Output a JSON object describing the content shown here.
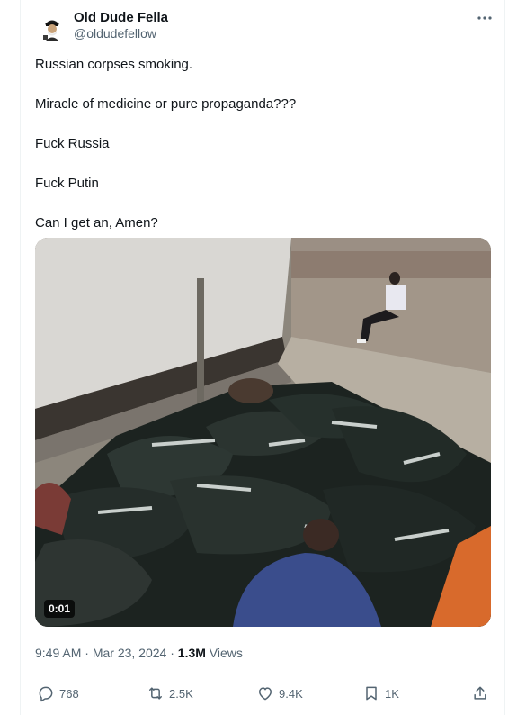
{
  "author": {
    "display_name": "Old Dude Fella",
    "handle": "@oldudefellow",
    "avatar_icon": "avatar-image"
  },
  "tweet": {
    "lines": [
      "Russian corpses smoking.",
      "Miracle of medicine or pure propaganda???",
      "Fuck Russia",
      "Fuck Putin",
      "Can I get an, Amen?"
    ]
  },
  "media": {
    "duration": "0:01"
  },
  "meta": {
    "time": "9:49 AM",
    "separator": "·",
    "date": "Mar 23, 2024",
    "views_count": "1.3M",
    "views_label": "Views"
  },
  "actions": {
    "replies": "768",
    "reposts": "2.5K",
    "likes": "9.4K",
    "bookmarks": "1K"
  },
  "colors": {
    "text_primary": "#0f1419",
    "text_secondary": "#536471",
    "border": "#eff3f4"
  }
}
